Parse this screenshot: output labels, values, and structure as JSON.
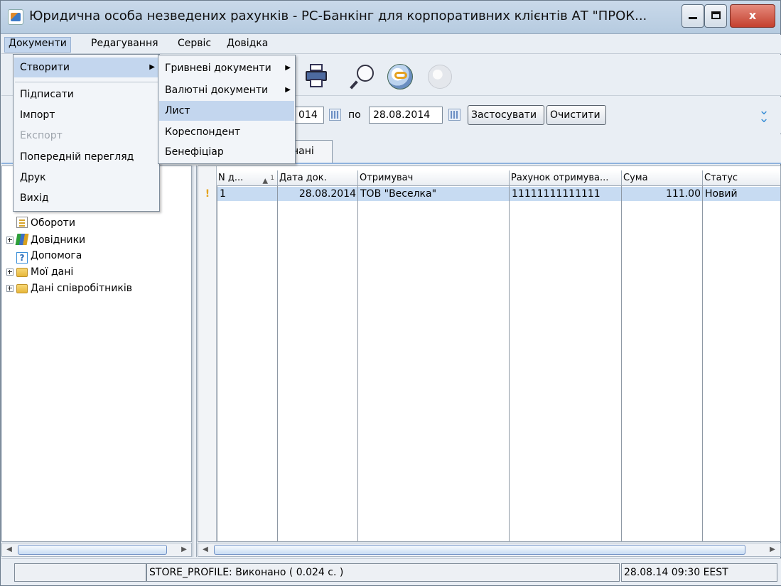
{
  "window": {
    "title": "Юридична особа незведених рахунків - РС-Банкінг для корпоративних клієнтів АТ \"ПРОК...",
    "min_glyph": "",
    "max_glyph": "",
    "close_glyph": "x"
  },
  "menubar": {
    "items": [
      "Документи",
      "Редагування",
      "Сервіс",
      "Довідка"
    ]
  },
  "documents_menu": {
    "items": [
      {
        "label": "Створити",
        "has_submenu": true,
        "active": true
      },
      {
        "label": "Підписати"
      },
      {
        "label": "Імпорт"
      },
      {
        "label": "Експорт",
        "disabled": true
      },
      {
        "label": "Попередній перегляд"
      },
      {
        "label": "Друк"
      },
      {
        "label": "Вихід"
      }
    ]
  },
  "create_submenu": {
    "items": [
      {
        "label": "Гривневі документи",
        "has_submenu": true
      },
      {
        "label": "Валютні документи",
        "has_submenu": true
      },
      {
        "label": "Лист",
        "active": true
      },
      {
        "label": "Кореспондент"
      },
      {
        "label": "Бенефіціар"
      }
    ]
  },
  "filter": {
    "date_from_visible": "014",
    "separator_label": "по",
    "date_to": "28.08.2014",
    "apply_label": "Застосувати",
    "clear_label": "Очистити"
  },
  "tabs": {
    "visible_tab_label": "нані"
  },
  "tree": {
    "items": [
      {
        "label": "Обороти",
        "icon": "turnover-icon",
        "expandable": false
      },
      {
        "label": "Довідники",
        "icon": "books-icon",
        "expandable": true
      },
      {
        "label": "Допомога",
        "icon": "help-icon",
        "expandable": false
      },
      {
        "label": "Мої дані",
        "icon": "folder-icon",
        "expandable": true
      },
      {
        "label": "Дані співробітників",
        "icon": "folder-icon",
        "expandable": true
      }
    ]
  },
  "table": {
    "columns": [
      "N д...",
      "Дата док.",
      "Отримувач",
      "Рахунок отримува...",
      "Сума",
      "Статус"
    ],
    "sort_indicator": "▲",
    "sort_order": "1",
    "row_marker": "!",
    "rows": [
      {
        "n": "1",
        "date": "28.08.2014",
        "recipient": "ТОВ \"Веселка\"",
        "account": "11111111111111",
        "sum": "111.00",
        "status": "Новий"
      }
    ]
  },
  "statusbar": {
    "left": "",
    "message": "STORE_PROFILE: Виконано ( 0.024 с. )",
    "datetime": "28.08.14 09:30 EEST"
  },
  "colors": {
    "selection": "#c7dbf2",
    "menu_highlight": "#c3d6ee",
    "close_button": "#c4402e"
  }
}
